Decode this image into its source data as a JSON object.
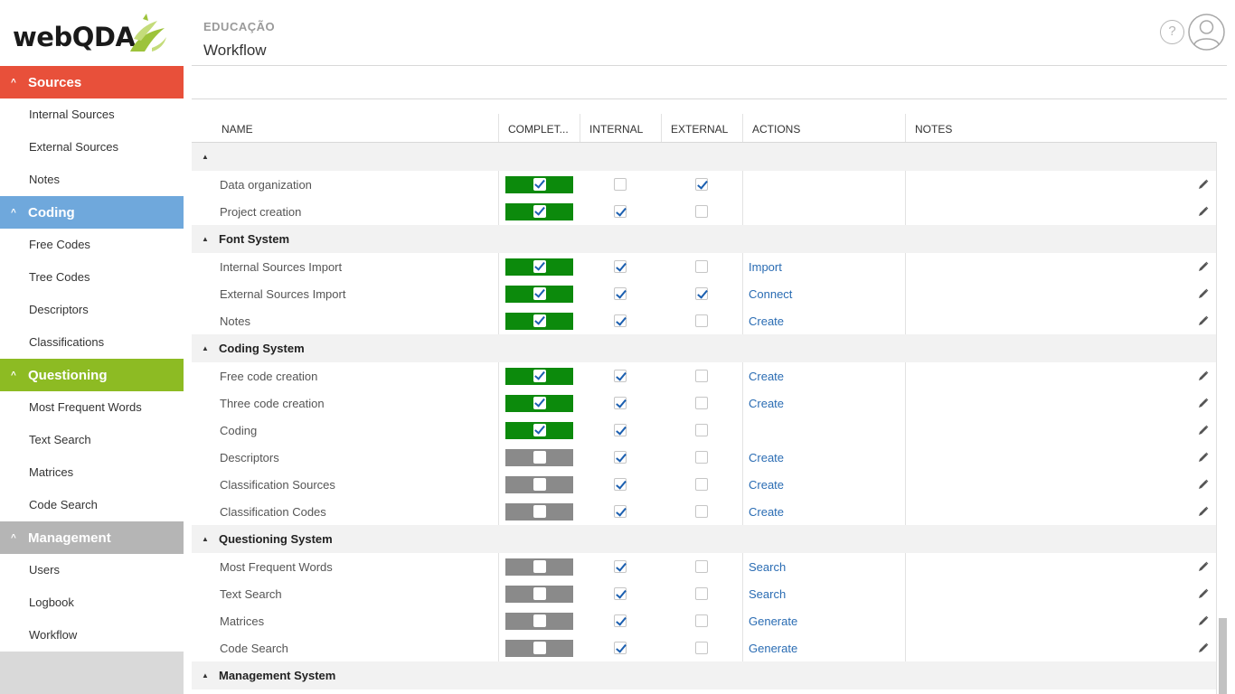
{
  "logo": {
    "text": "webQDA"
  },
  "sidebar": {
    "sections": [
      {
        "label": "Sources",
        "color": "#e8503a",
        "items": [
          "Internal Sources",
          "External Sources",
          "Notes"
        ]
      },
      {
        "label": "Coding",
        "color": "#6fa8dc",
        "items": [
          "Free Codes",
          "Tree Codes",
          "Descriptors",
          "Classifications"
        ]
      },
      {
        "label": "Questioning",
        "color": "#8dbb23",
        "items": [
          "Most Frequent Words",
          "Text Search",
          "Matrices",
          "Code Search"
        ]
      },
      {
        "label": "Management",
        "color": "#b5b5b5",
        "items": [
          "Users",
          "Logbook",
          "Workflow"
        ]
      }
    ]
  },
  "header": {
    "breadcrumb": "EDUCAÇÃO",
    "title": "Workflow",
    "help_icon": "?"
  },
  "grid": {
    "columns": [
      "NAME",
      "COMPLET...",
      "INTERNAL",
      "EXTERNAL",
      "ACTIONS",
      "NOTES"
    ],
    "groups": [
      {
        "label": "",
        "rows": [
          {
            "name": "Data organization",
            "complete": true,
            "internal": false,
            "external": true,
            "action": ""
          },
          {
            "name": "Project creation",
            "complete": true,
            "internal": true,
            "external": false,
            "action": ""
          }
        ]
      },
      {
        "label": "Font System",
        "rows": [
          {
            "name": "Internal Sources Import",
            "complete": true,
            "internal": true,
            "external": false,
            "action": "Import"
          },
          {
            "name": "External Sources Import",
            "complete": true,
            "internal": true,
            "external": true,
            "action": "Connect"
          },
          {
            "name": "Notes",
            "complete": true,
            "internal": true,
            "external": false,
            "action": "Create"
          }
        ]
      },
      {
        "label": "Coding System",
        "rows": [
          {
            "name": "Free code creation",
            "complete": true,
            "internal": true,
            "external": false,
            "action": "Create"
          },
          {
            "name": "Three code creation",
            "complete": true,
            "internal": true,
            "external": false,
            "action": "Create"
          },
          {
            "name": "Coding",
            "complete": true,
            "internal": true,
            "external": false,
            "action": ""
          },
          {
            "name": "Descriptors",
            "complete": false,
            "internal": true,
            "external": false,
            "action": "Create"
          },
          {
            "name": "Classification Sources",
            "complete": false,
            "internal": true,
            "external": false,
            "action": "Create"
          },
          {
            "name": "Classification Codes",
            "complete": false,
            "internal": true,
            "external": false,
            "action": "Create"
          }
        ]
      },
      {
        "label": "Questioning System",
        "rows": [
          {
            "name": "Most Frequent Words",
            "complete": false,
            "internal": true,
            "external": false,
            "action": "Search"
          },
          {
            "name": "Text Search",
            "complete": false,
            "internal": true,
            "external": false,
            "action": "Search"
          },
          {
            "name": "Matrices",
            "complete": false,
            "internal": true,
            "external": false,
            "action": "Generate"
          },
          {
            "name": "Code Search",
            "complete": false,
            "internal": true,
            "external": false,
            "action": "Generate"
          }
        ]
      },
      {
        "label": "Management System",
        "rows": []
      }
    ]
  }
}
